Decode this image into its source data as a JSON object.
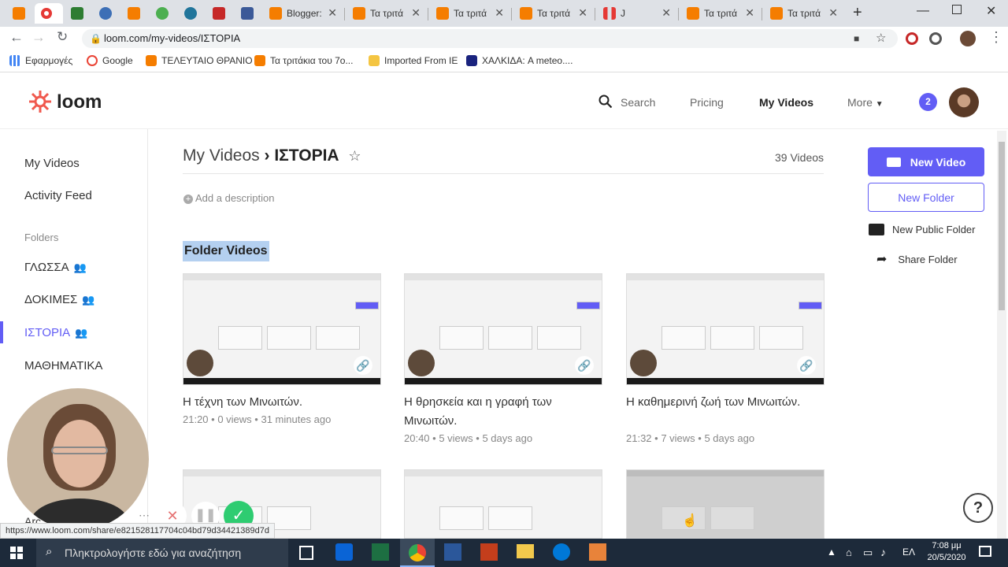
{
  "browser": {
    "tabs": [
      {
        "label": ""
      },
      {
        "label": ""
      },
      {
        "label": ""
      },
      {
        "label": ""
      },
      {
        "label": ""
      },
      {
        "label": ""
      },
      {
        "label": ""
      },
      {
        "label": ""
      },
      {
        "label": "Blogger:"
      },
      {
        "label": "Τα τριτά"
      },
      {
        "label": "Τα τριτά"
      },
      {
        "label": "Τα τριτά"
      },
      {
        "label": "J"
      },
      {
        "label": "Τα τριτά"
      },
      {
        "label": "Τα τριτά"
      }
    ],
    "url": "loom.com/my-videos/ΙΣΤΟΡΙΑ",
    "bookmarks": [
      {
        "label": "Εφαρμογές",
        "color": "#4285f4"
      },
      {
        "label": "Google",
        "color": "#ea4335"
      },
      {
        "label": "ΤΕΛΕΥΤΑΙΟ ΘΡΑΝΙΟ",
        "color": "#f57d00"
      },
      {
        "label": "Τα τριτάκια του 7ο...",
        "color": "#f57d00"
      },
      {
        "label": "Imported From IE",
        "color": "#f4c542"
      },
      {
        "label": "ΧΑΛΚΙΔΑ: A meteo....",
        "color": "#1a237e"
      }
    ],
    "status_url": "https://www.loom.com/share/e821528117704c04bd79d34421389d7d"
  },
  "loom": {
    "logo_text": "loom",
    "nav": {
      "search": "Search",
      "pricing": "Pricing",
      "my_videos": "My Videos",
      "more": "More",
      "notifications": "2"
    },
    "sidebar": {
      "my_videos": "My Videos",
      "activity_feed": "Activity Feed",
      "folders_heading": "Folders",
      "folders": [
        "ΓΛΩΣΣΑ",
        "ΔΟΚΙΜΕΣ",
        "ΙΣΤΟΡΙΑ",
        "ΜΑΘΗΜΑΤΙΚΑ"
      ],
      "partial_item": "Arc"
    },
    "main": {
      "breadcrumb_root": "My Videos",
      "breadcrumb_current": "ΙΣΤΟΡΙΑ",
      "video_count": "39 Videos",
      "add_description": "Add a description",
      "section_title": "Folder Videos",
      "videos": [
        {
          "title": "Η τέχνη των Μινωιτών.",
          "duration": "21:20",
          "views": "0 views",
          "age": "31 minutes ago"
        },
        {
          "title": "Η θρησκεία και η γραφή των Μινωιτών.",
          "duration": "20:40",
          "views": "5 views",
          "age": "5 days ago"
        },
        {
          "title": "Η καθημερινή ζωή των Μινωιτών.",
          "duration": "21:32",
          "views": "7 views",
          "age": "5 days ago"
        }
      ]
    },
    "actions": {
      "new_video": "New Video",
      "new_folder": "New Folder",
      "new_public_folder": "New Public Folder",
      "share_folder": "Share Folder",
      "help": "?"
    },
    "colors": {
      "brand": "#625df5",
      "logo": "#f0594e",
      "active": "#625df5"
    }
  },
  "taskbar": {
    "search_placeholder": "Πληκτρολογήστε εδώ για αναζήτηση",
    "language": "ΕΛ",
    "time": "7:08 μμ",
    "date": "20/5/2020"
  }
}
